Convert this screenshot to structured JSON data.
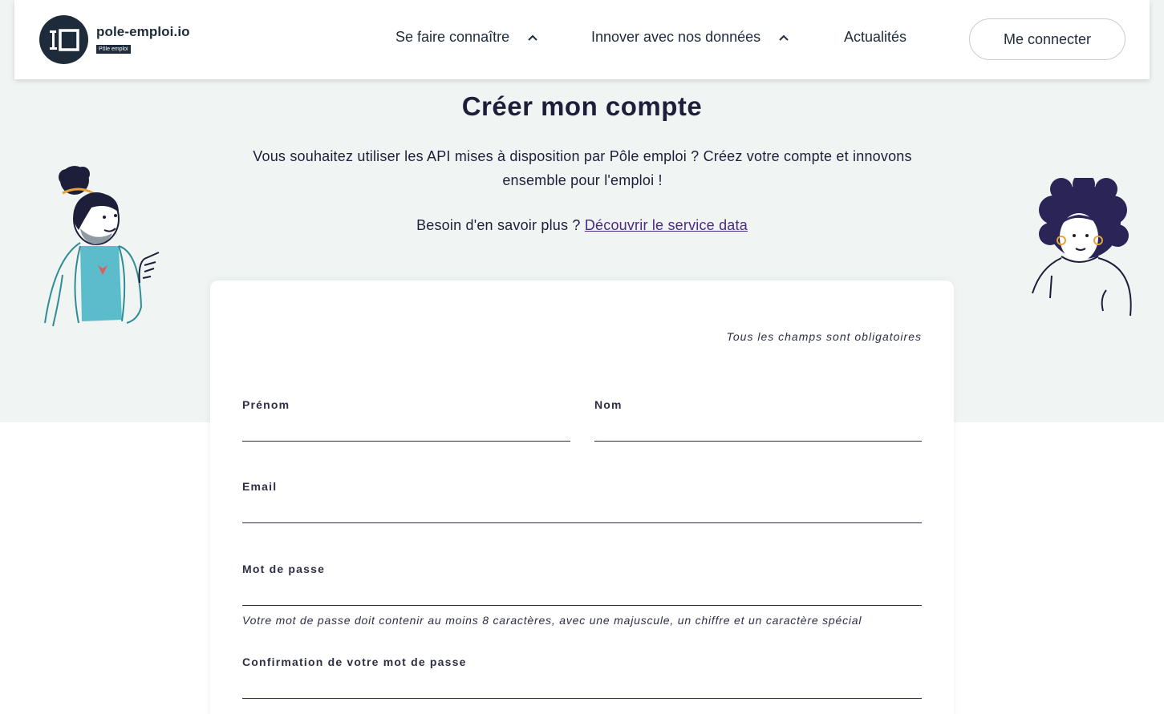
{
  "header": {
    "logo_name": "pole-emploi.io",
    "logo_badge": "Pôle emploi",
    "nav": [
      {
        "label": "Se faire connaître",
        "has_chevron": true
      },
      {
        "label": "Innover avec nos données",
        "has_chevron": true
      },
      {
        "label": "Actualités",
        "has_chevron": false
      }
    ],
    "login_label": "Me connecter"
  },
  "main": {
    "title": "Créer mon compte",
    "intro_line1": "Vous souhaitez utiliser les API mises à disposition par Pôle emploi ? Créez votre compte et innovons",
    "intro_line2": "ensemble pour l'emploi !",
    "more_text": "Besoin d'en savoir plus ?",
    "more_link": "Découvrir le service data"
  },
  "form": {
    "required_note": "Tous les champs sont obligatoires",
    "firstname_label": "Prénom",
    "lastname_label": "Nom",
    "email_label": "Email",
    "password_label": "Mot de passe",
    "password_hint": "Votre mot de passe doit contenir au moins 8 caractères, avec une majuscule, un chiffre et un caractère spécial",
    "confirm_label": "Confirmation de votre mot de passe",
    "firstname_value": "",
    "lastname_value": "",
    "email_value": "",
    "password_value": "",
    "confirm_value": ""
  },
  "colors": {
    "hero_bg": "#f0f5f3",
    "primary_text": "#1d1f3a",
    "link": "#4b2a86",
    "logo_bg": "#1d2b3a",
    "illus_shirt": "#5bbdcc",
    "illus_heart": "#e8585a",
    "illus_accent": "#e8a33a"
  },
  "icons": [
    "logo-io-icon",
    "chevron-up-icon",
    "woman-pointing-illustration",
    "woman-curly-hair-illustration"
  ]
}
